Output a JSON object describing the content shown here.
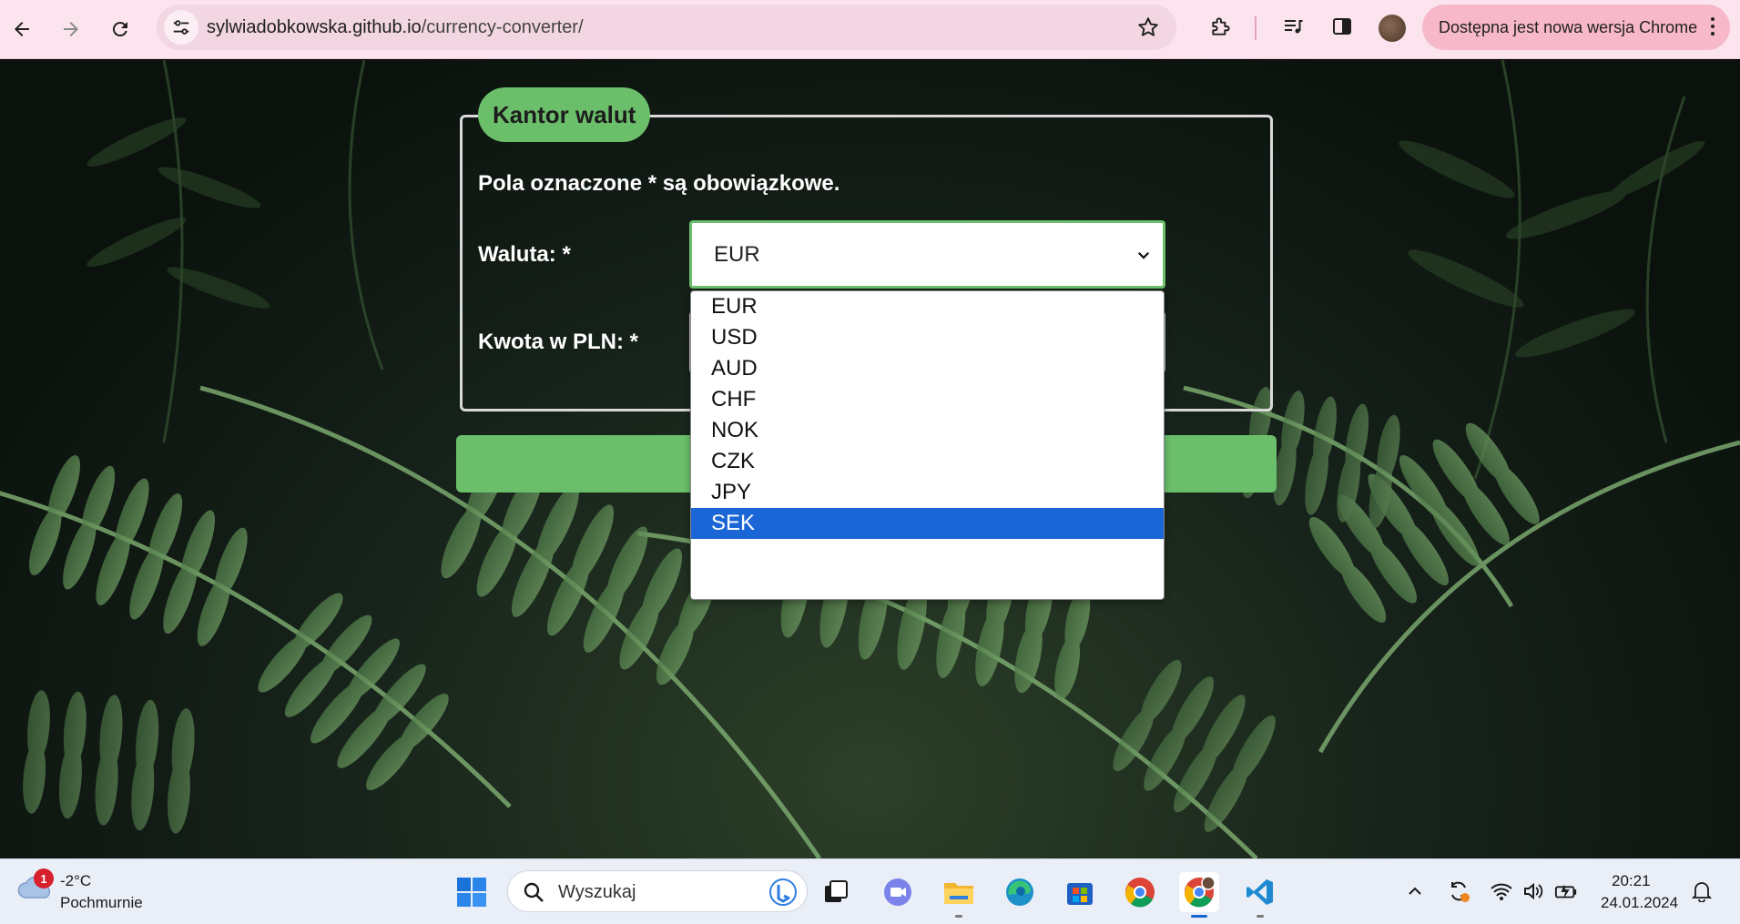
{
  "browser": {
    "url_host": "sylwiadobkowska.github.io",
    "url_path": "/currency-converter/",
    "update_label": "Dostępna jest nowa wersja Chrome"
  },
  "form": {
    "legend": "Kantor walut",
    "required_note": "Pola oznaczone * są obowiązkowe.",
    "currency_label": "Waluta: *",
    "amount_label": "Kwota w PLN: *",
    "currency_value": "EUR",
    "currency_options": [
      "EUR",
      "USD",
      "AUD",
      "CHF",
      "NOK",
      "CZK",
      "JPY",
      "SEK"
    ],
    "highlighted_option": "SEK"
  },
  "colors": {
    "accent": "#6bbf6b",
    "highlight": "#1a66d6",
    "browser_bar": "#fbe4ee"
  },
  "taskbar": {
    "weather_badge": "1",
    "weather_temp": "-2°C",
    "weather_desc": "Pochmurnie",
    "search_placeholder": "Wyszukaj",
    "time": "20:21",
    "date": "24.01.2024",
    "apps": [
      "windows-start-icon",
      "task-view-icon",
      "teams-icon",
      "file-explorer-icon",
      "edge-icon",
      "store-icon",
      "chrome-icon",
      "chrome-profile-icon",
      "vscode-icon"
    ]
  }
}
